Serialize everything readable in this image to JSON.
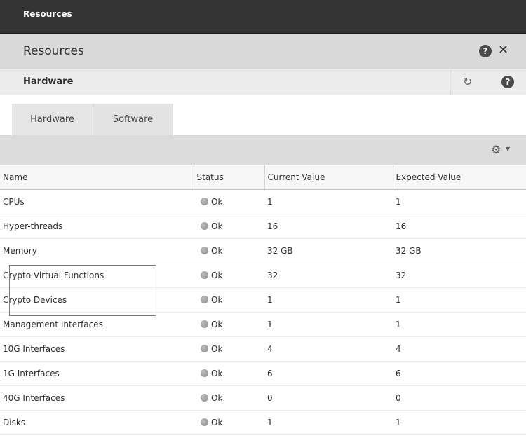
{
  "window": {
    "title": "Resources"
  },
  "panel": {
    "title": "Resources",
    "help_glyph": "?",
    "close_glyph": "✕"
  },
  "section": {
    "title": "Hardware",
    "refresh_glyph": "↻",
    "help_glyph": "?"
  },
  "tabs": [
    {
      "label": "Hardware",
      "active": true
    },
    {
      "label": "Software",
      "active": false
    }
  ],
  "toolbar": {
    "gear_glyph": "⚙",
    "caret_glyph": "▼"
  },
  "table": {
    "columns": [
      "Name",
      "Status",
      "Current Value",
      "Expected Value"
    ],
    "rows": [
      {
        "name": "CPUs",
        "status": "Ok",
        "current": "1",
        "expected": "1"
      },
      {
        "name": "Hyper-threads",
        "status": "Ok",
        "current": "16",
        "expected": "16"
      },
      {
        "name": "Memory",
        "status": "Ok",
        "current": "32 GB",
        "expected": "32 GB"
      },
      {
        "name": "Crypto Virtual Functions",
        "status": "Ok",
        "current": "32",
        "expected": "32"
      },
      {
        "name": "Crypto Devices",
        "status": "Ok",
        "current": "1",
        "expected": "1"
      },
      {
        "name": "Management Interfaces",
        "status": "Ok",
        "current": "1",
        "expected": "1"
      },
      {
        "name": "10G Interfaces",
        "status": "Ok",
        "current": "4",
        "expected": "4"
      },
      {
        "name": "1G Interfaces",
        "status": "Ok",
        "current": "6",
        "expected": "6"
      },
      {
        "name": "40G Interfaces",
        "status": "Ok",
        "current": "0",
        "expected": "0"
      },
      {
        "name": "Disks",
        "status": "Ok",
        "current": "1",
        "expected": "1"
      }
    ]
  },
  "colors": {
    "titlebar": "#333333",
    "panel_header": "#d9d9d9",
    "section_header": "#ececec",
    "toolbar": "#dcdcdc",
    "status_ok_dot": "#9e9e9e"
  }
}
